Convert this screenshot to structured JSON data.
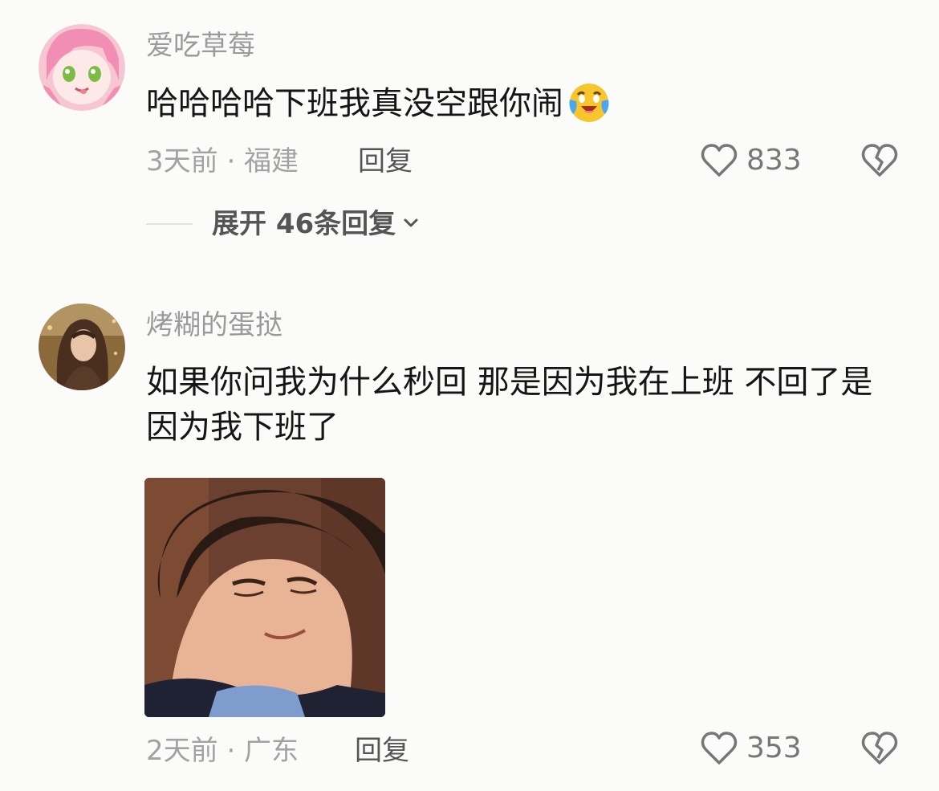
{
  "comments": [
    {
      "username": "爱吃草莓",
      "text": "哈哈哈哈下班我真没空跟你闹",
      "emoji": "crying-laughing-emoji",
      "meta": "3天前 · 福建",
      "reply_label": "回复",
      "likes": "833",
      "expand_label": "展开 46条回复",
      "avatar": "pink-hair-anime-girl-avatar"
    },
    {
      "username": "烤糊的蛋挞",
      "text": "如果你问我为什么秒回 那是因为我在上班  不回了是因为我下班了",
      "meta": "2天前 · 广东",
      "reply_label": "回复",
      "likes": "353",
      "avatar": "woman-long-hair-photo-avatar",
      "image": "man-smirking-meme-image"
    }
  ],
  "icons": {
    "like": "heart-outline-icon",
    "dislike": "broken-heart-icon",
    "expand": "chevron-down-icon"
  },
  "colors": {
    "background": "#fbfbf9",
    "username": "#9a9a9a",
    "text": "#151515",
    "meta": "#a2a2a2"
  }
}
